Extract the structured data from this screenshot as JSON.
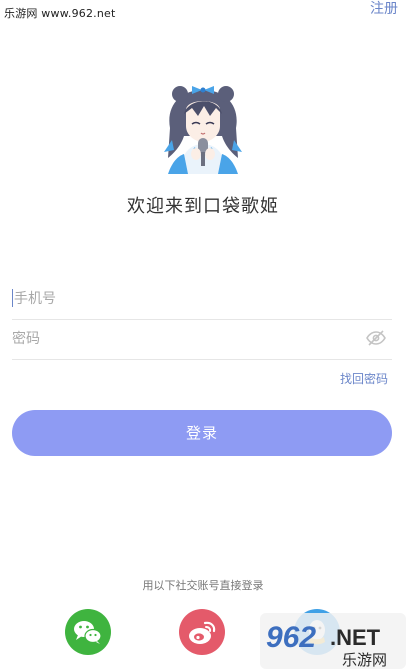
{
  "watermark_top": "乐游网 www.962.net",
  "header": {
    "register_label": "注册"
  },
  "welcome_text": "欢迎来到口袋歌姬",
  "form": {
    "phone_placeholder": "手机号",
    "password_placeholder": "密码",
    "forgot_label": "找回密码",
    "login_label": "登录"
  },
  "social": {
    "hint": "用以下社交账号直接登录",
    "items": [
      {
        "name": "wechat",
        "icon": "wechat-icon",
        "color": "#3fb43f"
      },
      {
        "name": "weibo",
        "icon": "weibo-icon",
        "color": "#e45a6a"
      },
      {
        "name": "qq",
        "icon": "qq-icon",
        "color": "#3fa0e6"
      }
    ]
  },
  "watermark_badge": {
    "number": "962",
    "suffix": ".NET",
    "site": "乐游网"
  },
  "colors": {
    "accent": "#6b86c9",
    "button": "#8e9bf3"
  }
}
